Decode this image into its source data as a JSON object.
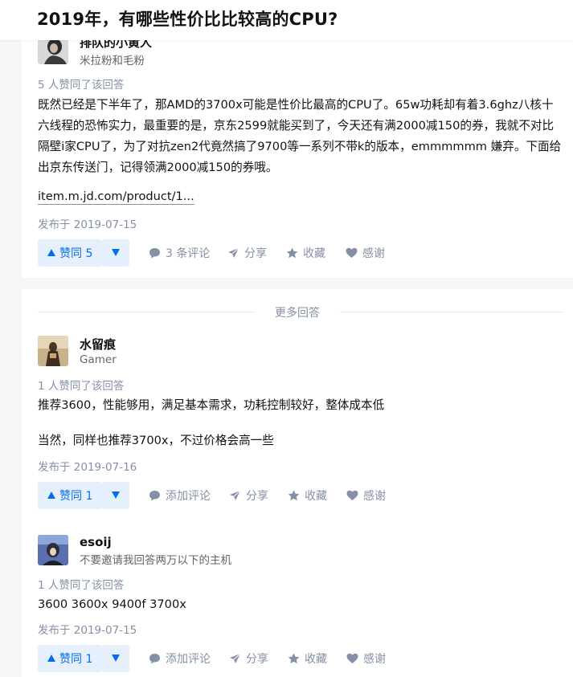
{
  "header": {
    "title": "2019年，有哪些性价比比较高的CPU?"
  },
  "answers": [
    {
      "author_name": "排队的小黄人",
      "author_bio": "米拉粉和毛粉",
      "votes_text": "5 人赞同了该回答",
      "paragraphs": [
        "既然已经是下半年了，那AMD的3700x可能是性价比最高的CPU了。65w功耗却有着3.6ghz八核十六线程的恐怖实力，最重要的是，京东2599就能买到了，今天还有满2000减150的券，我就不对比隔壁i家CPU了，为了对抗zen2代竟然搞了9700等一系列不带k的版本，emmmmmm 嫌弃。下面给出京东传送门，记得领满2000减150的券哦。"
      ],
      "link_text": "item.m.jd.com/product/1...",
      "date": "发布于 2019-07-15",
      "upvote_label": "赞同 5",
      "comment_label": "3 条评论",
      "share_label": "分享",
      "collect_label": "收藏",
      "thanks_label": "感谢"
    },
    {
      "author_name": "水留痕",
      "author_bio": "Gamer",
      "votes_text": "1 人赞同了该回答",
      "paragraphs": [
        "推荐3600，性能够用，满足基本需求，功耗控制较好，整体成本低",
        "当然，同样也推荐3700x，不过价格会高一些"
      ],
      "date": "发布于 2019-07-16",
      "upvote_label": "赞同 1",
      "comment_label": "添加评论",
      "share_label": "分享",
      "collect_label": "收藏",
      "thanks_label": "感谢"
    },
    {
      "author_name": "esoij",
      "author_bio": "不要邀请我回答两万以下的主机",
      "votes_text": "1 人赞同了该回答",
      "paragraphs": [
        "3600 3600x 9400f 3700x"
      ],
      "date": "发布于 2019-07-15",
      "upvote_label": "赞同 1",
      "comment_label": "添加评论",
      "share_label": "分享",
      "collect_label": "收藏",
      "thanks_label": "感谢"
    }
  ],
  "more_answers_label": "更多回答",
  "colors": {
    "accent": "#056de8",
    "muted": "#8590a6",
    "text": "#121212"
  },
  "icons": [
    "triangle-up-icon",
    "triangle-down-icon",
    "comment-icon",
    "share-icon",
    "star-icon",
    "heart-icon"
  ]
}
